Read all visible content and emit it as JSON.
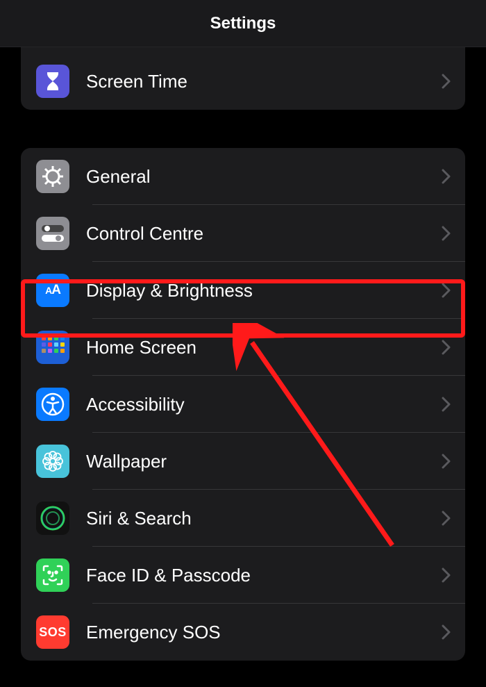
{
  "header": {
    "title": "Settings"
  },
  "group1": {
    "items": [
      {
        "label": "Screen Time"
      }
    ]
  },
  "group2": {
    "items": [
      {
        "label": "General"
      },
      {
        "label": "Control Centre"
      },
      {
        "label": "Display & Brightness"
      },
      {
        "label": "Home Screen"
      },
      {
        "label": "Accessibility"
      },
      {
        "label": "Wallpaper"
      },
      {
        "label": "Siri & Search"
      },
      {
        "label": "Face ID & Passcode"
      },
      {
        "label": "Emergency SOS"
      }
    ]
  },
  "annotation": {
    "highlight_target": "Display & Brightness"
  }
}
